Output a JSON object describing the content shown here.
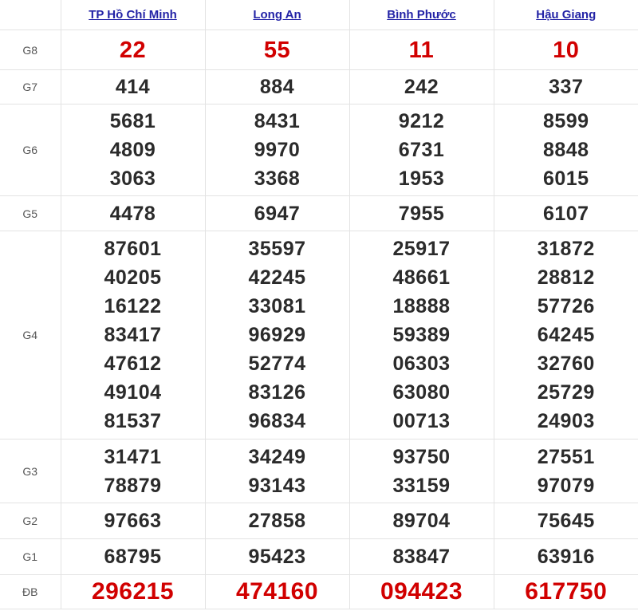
{
  "provinces": [
    "TP Hồ Chí Minh",
    "Long An",
    "Bình Phước",
    "Hậu Giang"
  ],
  "rows": [
    {
      "prize": "G8",
      "special": true,
      "values": [
        [
          "22"
        ],
        [
          "55"
        ],
        [
          "11"
        ],
        [
          "10"
        ]
      ]
    },
    {
      "prize": "G7",
      "special": false,
      "values": [
        [
          "414"
        ],
        [
          "884"
        ],
        [
          "242"
        ],
        [
          "337"
        ]
      ]
    },
    {
      "prize": "G6",
      "special": false,
      "values": [
        [
          "5681",
          "4809",
          "3063"
        ],
        [
          "8431",
          "9970",
          "3368"
        ],
        [
          "9212",
          "6731",
          "1953"
        ],
        [
          "8599",
          "8848",
          "6015"
        ]
      ]
    },
    {
      "prize": "G5",
      "special": false,
      "values": [
        [
          "4478"
        ],
        [
          "6947"
        ],
        [
          "7955"
        ],
        [
          "6107"
        ]
      ]
    },
    {
      "prize": "G4",
      "special": false,
      "values": [
        [
          "87601",
          "40205",
          "16122",
          "83417",
          "47612",
          "49104",
          "81537"
        ],
        [
          "35597",
          "42245",
          "33081",
          "96929",
          "52774",
          "83126",
          "96834"
        ],
        [
          "25917",
          "48661",
          "18888",
          "59389",
          "06303",
          "63080",
          "00713"
        ],
        [
          "31872",
          "28812",
          "57726",
          "64245",
          "32760",
          "25729",
          "24903"
        ]
      ]
    },
    {
      "prize": "G3",
      "special": false,
      "values": [
        [
          "31471",
          "78879"
        ],
        [
          "34249",
          "93143"
        ],
        [
          "93750",
          "33159"
        ],
        [
          "27551",
          "97079"
        ]
      ]
    },
    {
      "prize": "G2",
      "special": false,
      "values": [
        [
          "97663"
        ],
        [
          "27858"
        ],
        [
          "89704"
        ],
        [
          "75645"
        ]
      ]
    },
    {
      "prize": "G1",
      "special": false,
      "values": [
        [
          "68795"
        ],
        [
          "95423"
        ],
        [
          "83847"
        ],
        [
          "63916"
        ]
      ]
    },
    {
      "prize": "ĐB",
      "special": true,
      "values": [
        [
          "296215"
        ],
        [
          "474160"
        ],
        [
          "094423"
        ],
        [
          "617750"
        ]
      ]
    }
  ],
  "colors": {
    "special": "#d10000",
    "normal": "#2b2b2b",
    "link": "#2323a6"
  }
}
